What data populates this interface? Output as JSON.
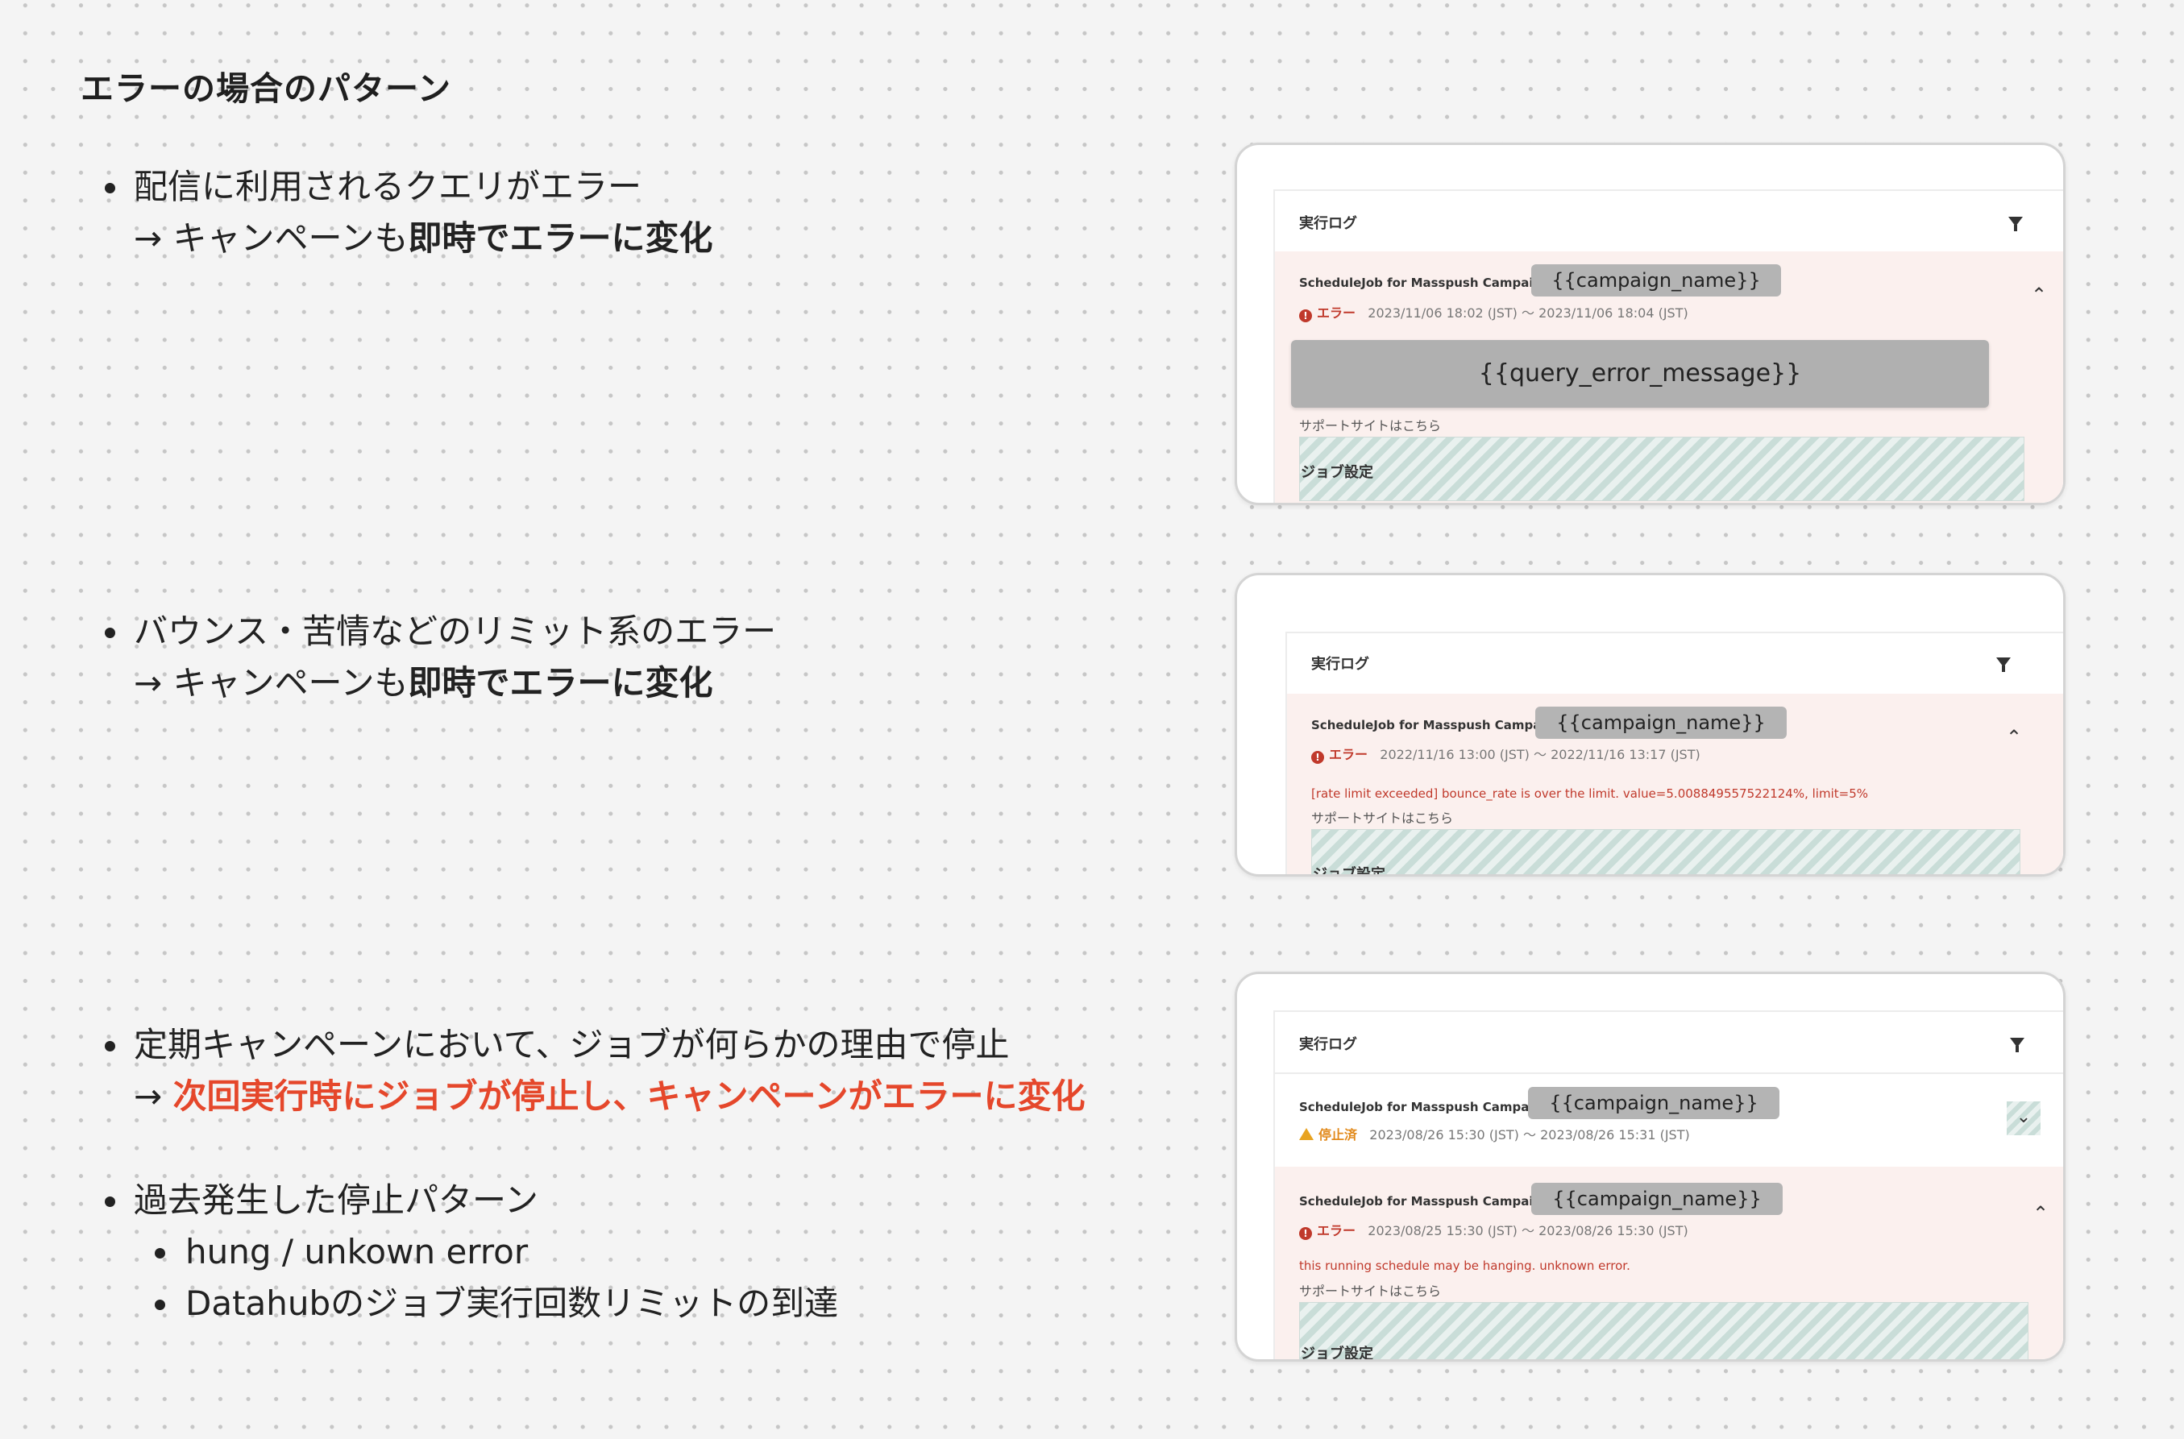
{
  "title": "エラーの場合のパターン",
  "bullets": {
    "b1": {
      "line1": "配信に利用されるクエリがエラー",
      "arrow": "→ キャンペーンも",
      "emph": "即時でエラーに変化"
    },
    "b2": {
      "line1": "バウンス・苦情などのリミット系のエラー",
      "arrow": "→ キャンペーンも",
      "emph": "即時でエラーに変化"
    },
    "b3": {
      "line1": "定期キャンペーンにおいて、ジョブが何らかの理由で停止",
      "arrow": "→ ",
      "emph": "次回実行時にジョブが停止し、キャンペーンがエラーに変化"
    },
    "b4": {
      "line1": "過去発生した停止パターン",
      "sub": [
        "hung / unkown error",
        "Datahubのジョブ実行回数リミットの到達"
      ]
    }
  },
  "cards": {
    "c1": {
      "log_header": "実行ログ",
      "job_title": "ScheduleJob for Masspush Campaign:",
      "campaign_pill": "{{campaign_name}}",
      "status_label": "エラー",
      "time_range": "2023/11/06 18:02 (JST) 〜 2023/11/06 18:04 (JST)",
      "error_pill": "{{query_error_message}}",
      "support": "サポートサイトはこちら",
      "job_settings": "ジョブ設定"
    },
    "c2": {
      "log_header": "実行ログ",
      "job_title": "ScheduleJob for Masspush Campaign:",
      "campaign_pill": "{{campaign_name}}",
      "status_label": "エラー",
      "time_range": "2022/11/16 13:00 (JST) 〜 2022/11/16 13:17 (JST)",
      "error_message": "[rate limit exceeded] bounce_rate is over the limit. value=5.008849557522124%, limit=5%",
      "support": "サポートサイトはこちら",
      "job_settings": "ジョブ設定"
    },
    "c3": {
      "log_header": "実行ログ",
      "job1_title": "ScheduleJob for Masspush Campaign:",
      "job1_pill": "{{campaign_name}}",
      "job1_status": "停止済",
      "job1_time": "2023/08/26 15:30 (JST) 〜 2023/08/26 15:31 (JST)",
      "job2_title": "ScheduleJob for Masspush Campaign:",
      "job2_pill": "{{campaign_name}}",
      "job2_status": "エラー",
      "job2_time": "2023/08/25 15:30 (JST) 〜 2023/08/26 15:30 (JST)",
      "error_message": "this running schedule may be hanging. unknown error.",
      "support": "サポートサイトはこちら",
      "job_settings": "ジョブ設定"
    }
  },
  "icons": {
    "filter": "filter-icon",
    "error": "error-circle-icon",
    "warning": "warning-triangle-icon",
    "chevron_up": "chevron-up-icon",
    "chevron_down": "chevron-down-icon"
  },
  "colors": {
    "accent_red": "#e5472b",
    "error_red": "#c0392b",
    "warning_orange": "#e28a1c",
    "error_bg": "#fbf0ee"
  }
}
